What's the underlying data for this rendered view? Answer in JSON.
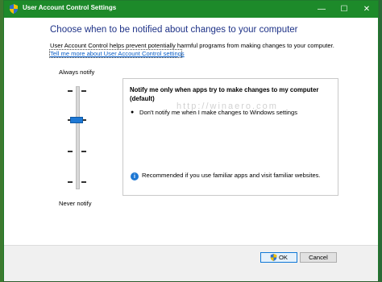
{
  "window": {
    "title": "User Account Control Settings",
    "controls": {
      "minimize": "—",
      "maximize": "☐",
      "close": "✕"
    }
  },
  "main": {
    "heading": "Choose when to be notified about changes to your computer",
    "description": "User Account Control helps prevent potentially harmful programs from making changes to your computer.",
    "link": "Tell me more about User Account Control settings"
  },
  "slider": {
    "top_label": "Always notify",
    "bottom_label": "Never notify",
    "levels": 4,
    "selected_level": 3
  },
  "panel": {
    "title": "Notify me only when apps try to make changes to my computer (default)",
    "bullets": [
      "Don't notify me when I make changes to Windows settings"
    ],
    "watermark": "http://winaero.com",
    "info": "Recommended if you use familiar apps and visit familiar websites."
  },
  "footer": {
    "ok_label": "OK",
    "cancel_label": "Cancel"
  },
  "colors": {
    "titlebar": "#1d8a2a",
    "heading": "#1e3287",
    "accent": "#1e78d4",
    "link": "#0b5fc8"
  }
}
